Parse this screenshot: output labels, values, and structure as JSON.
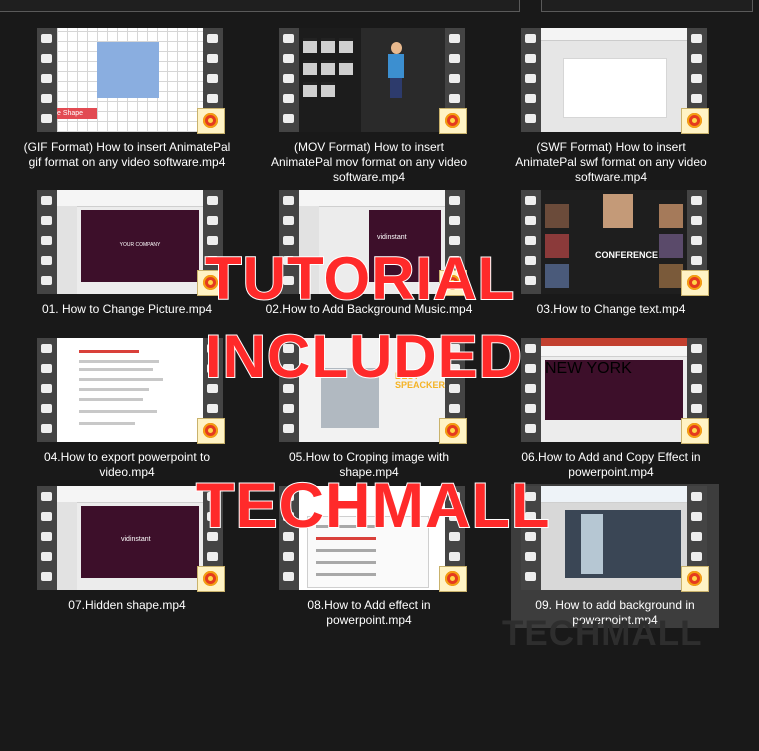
{
  "files": [
    {
      "label": "(GIF Format) How to insert AnimatePal gif format on any video software.mp4",
      "thumb_text": "e Shape"
    },
    {
      "label": "(MOV Format) How to insert AnimatePal mov format on any video software.mp4"
    },
    {
      "label": "(SWF Format) How to insert AnimatePal swf format on any video software.mp4"
    },
    {
      "label": "01. How to Change Picture.mp4",
      "thumb_text": "YOUR COMPANY"
    },
    {
      "label": "02.How to Add Background Music.mp4",
      "thumb_text": "vidinstant"
    },
    {
      "label": "03.How to Change text.mp4",
      "thumb_text": "CONFERENCE"
    },
    {
      "label": "04.How to export powerpoint to video.mp4"
    },
    {
      "label": "05.How to Croping image with shape.mp4",
      "thumb_text": "BEST SPEACKERS"
    },
    {
      "label": "06.How to Add and Copy Effect in powerpoint.mp4",
      "thumb_text": "NEW YORK"
    },
    {
      "label": "07.Hidden shape.mp4",
      "thumb_text": "vidinstant"
    },
    {
      "label": "08.How to Add effect in powerpoint.mp4"
    },
    {
      "label": "09. How to add background in powerpoint.mp4"
    }
  ],
  "overlay": {
    "line1": "TUTORIAL",
    "line2": "INCLUDED",
    "line3": "TECHMALL",
    "watermark": "TECHMALL"
  },
  "colors": {
    "overlay_text": "#ff2a2a",
    "outline": "#ffffff",
    "background": "#191919"
  }
}
